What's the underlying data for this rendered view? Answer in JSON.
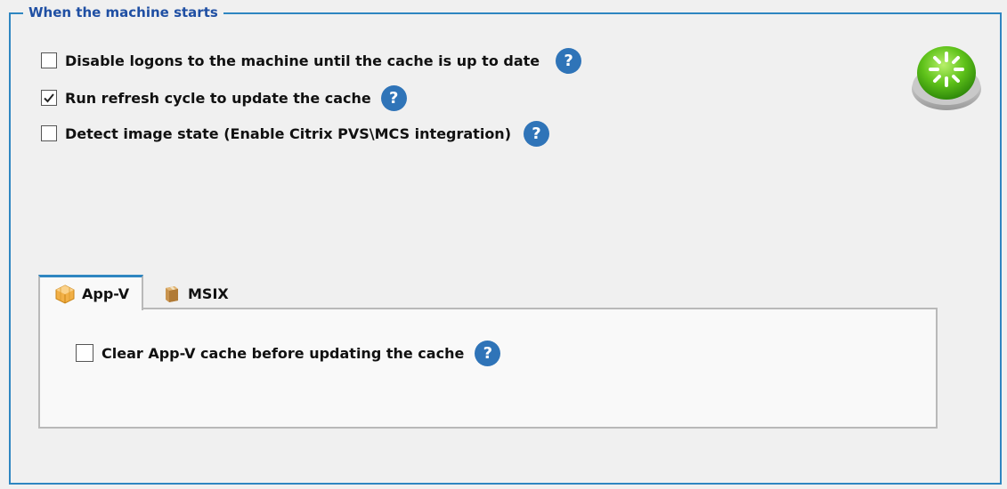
{
  "group": {
    "title": "When the machine starts"
  },
  "options": [
    {
      "label": "Disable logons to the machine until the cache is up to date",
      "checked": false,
      "help": "?"
    },
    {
      "label": "Run refresh cycle to update the cache",
      "checked": true,
      "help": "?"
    },
    {
      "label": "Detect image state (Enable Citrix PVS\\MCS integration)",
      "checked": false,
      "help": "?"
    }
  ],
  "status_icon": "green-refresh-orb-icon",
  "tabs": [
    {
      "label": "App-V",
      "icon": "appv-package-icon",
      "active": true
    },
    {
      "label": "MSIX",
      "icon": "msix-box-icon",
      "active": false
    }
  ],
  "appv_panel": {
    "option": {
      "label": "Clear App-V cache before updating the cache",
      "checked": false,
      "help": "?"
    }
  },
  "colors": {
    "accent": "#2e86c1",
    "legend_text": "#1f4fa3",
    "help_badge": "#2f74b8",
    "orb_green": "#5fc21a"
  }
}
